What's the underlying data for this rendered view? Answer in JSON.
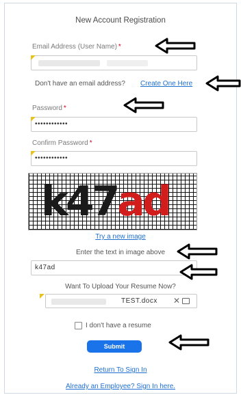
{
  "header": {
    "title": "New Account Registration"
  },
  "email": {
    "label": "Email Address (User Name)",
    "required_mark": "*"
  },
  "no_email": {
    "text": "Don't have an email address?",
    "link": "Create One Here"
  },
  "password": {
    "label": "Password",
    "required_mark": "*",
    "value": "••••••••••••"
  },
  "confirm_password": {
    "label": "Confirm Password",
    "required_mark": "*",
    "value": "••••••••••••"
  },
  "captcha": {
    "image_text_main": "k47",
    "image_text_red": "ad",
    "refresh_link": "Try a new image",
    "prompt": "Enter the text in image above",
    "value": "k47ad"
  },
  "resume": {
    "question": "Want To Upload Your Resume Now?",
    "file_name": "TEST.docx",
    "no_resume_label": "I don't have a resume"
  },
  "buttons": {
    "submit": "Submit"
  },
  "footer": {
    "return_link": "Return To Sign In",
    "employee_link": "Already an Employee? Sign In here."
  },
  "colors": {
    "accent": "#1a73e8",
    "link": "#1f6fd1",
    "required": "#d0021b",
    "flag": "#e8c21a"
  }
}
